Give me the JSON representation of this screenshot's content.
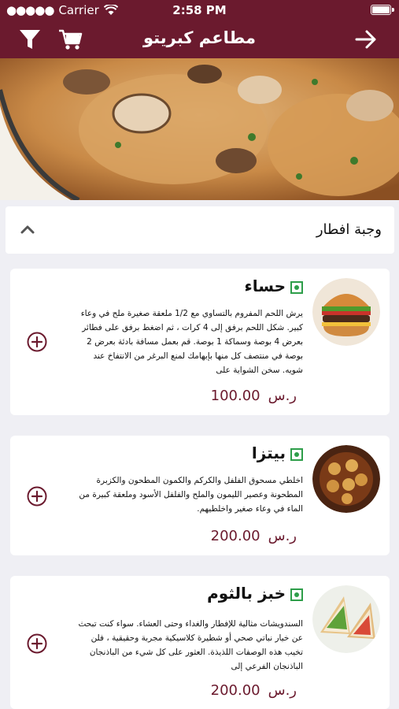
{
  "status_bar": {
    "carrier": "Carrier",
    "time": "2:58 PM",
    "battery_level": 1.0
  },
  "header": {
    "title": "مطاعم كبريتو"
  },
  "category": {
    "label": "وجبة افطار"
  },
  "items": [
    {
      "name": "حساء",
      "description": "يرش اللحم المفروم بالتساوي مع 1/2 ملعقة صغيرة ملح في وعاء كبير. شكل اللحم برفق إلى 4 كرات ، ثم اضغط برفق على فطائر بعرض 4 بوصة وسماكة 1 بوصة. قم بعمل مسافة بادئة بعرض 2 بوصة في منتصف كل منها بإبهامك لمنع البرغر من الانتفاخ عند شويه. سخن الشواية على",
      "price": "100.00",
      "currency": "ر.س"
    },
    {
      "name": "بيتزا",
      "description": "اخلطي مسحوق الفلفل والكركم والكمون المطحون والكزبرة المطحونة وعصير الليمون والملح والفلفل الأسود وملعقة كبيرة من الماء في وعاء صغير واخلطيهم.",
      "price": "200.00",
      "currency": "ر.س"
    },
    {
      "name": "خبز بالثوم",
      "description": "السندويشات مثالية للإفطار والغداء وحتى العشاء. سواء كنت تبحث عن خيار نباتي صحي أو شطيرة كلاسيكية مجربة وحقيقية ، فلن تخيب هذه الوصفات اللذيذة. العثور على كل شيء من الباذنجان الباذنجان الفرعي إلى",
      "price": "200.00",
      "currency": "ر.س"
    }
  ],
  "icons": {
    "back": "arrow-right-icon",
    "cart": "cart-icon",
    "filter": "filter-icon",
    "collapse": "chevron-up-icon",
    "add": "plus-circle-icon",
    "veg": "veg-indicator-icon"
  },
  "colors": {
    "brand": "#6b1a2e",
    "veg": "#2e9e4a",
    "background": "#efeff4"
  }
}
